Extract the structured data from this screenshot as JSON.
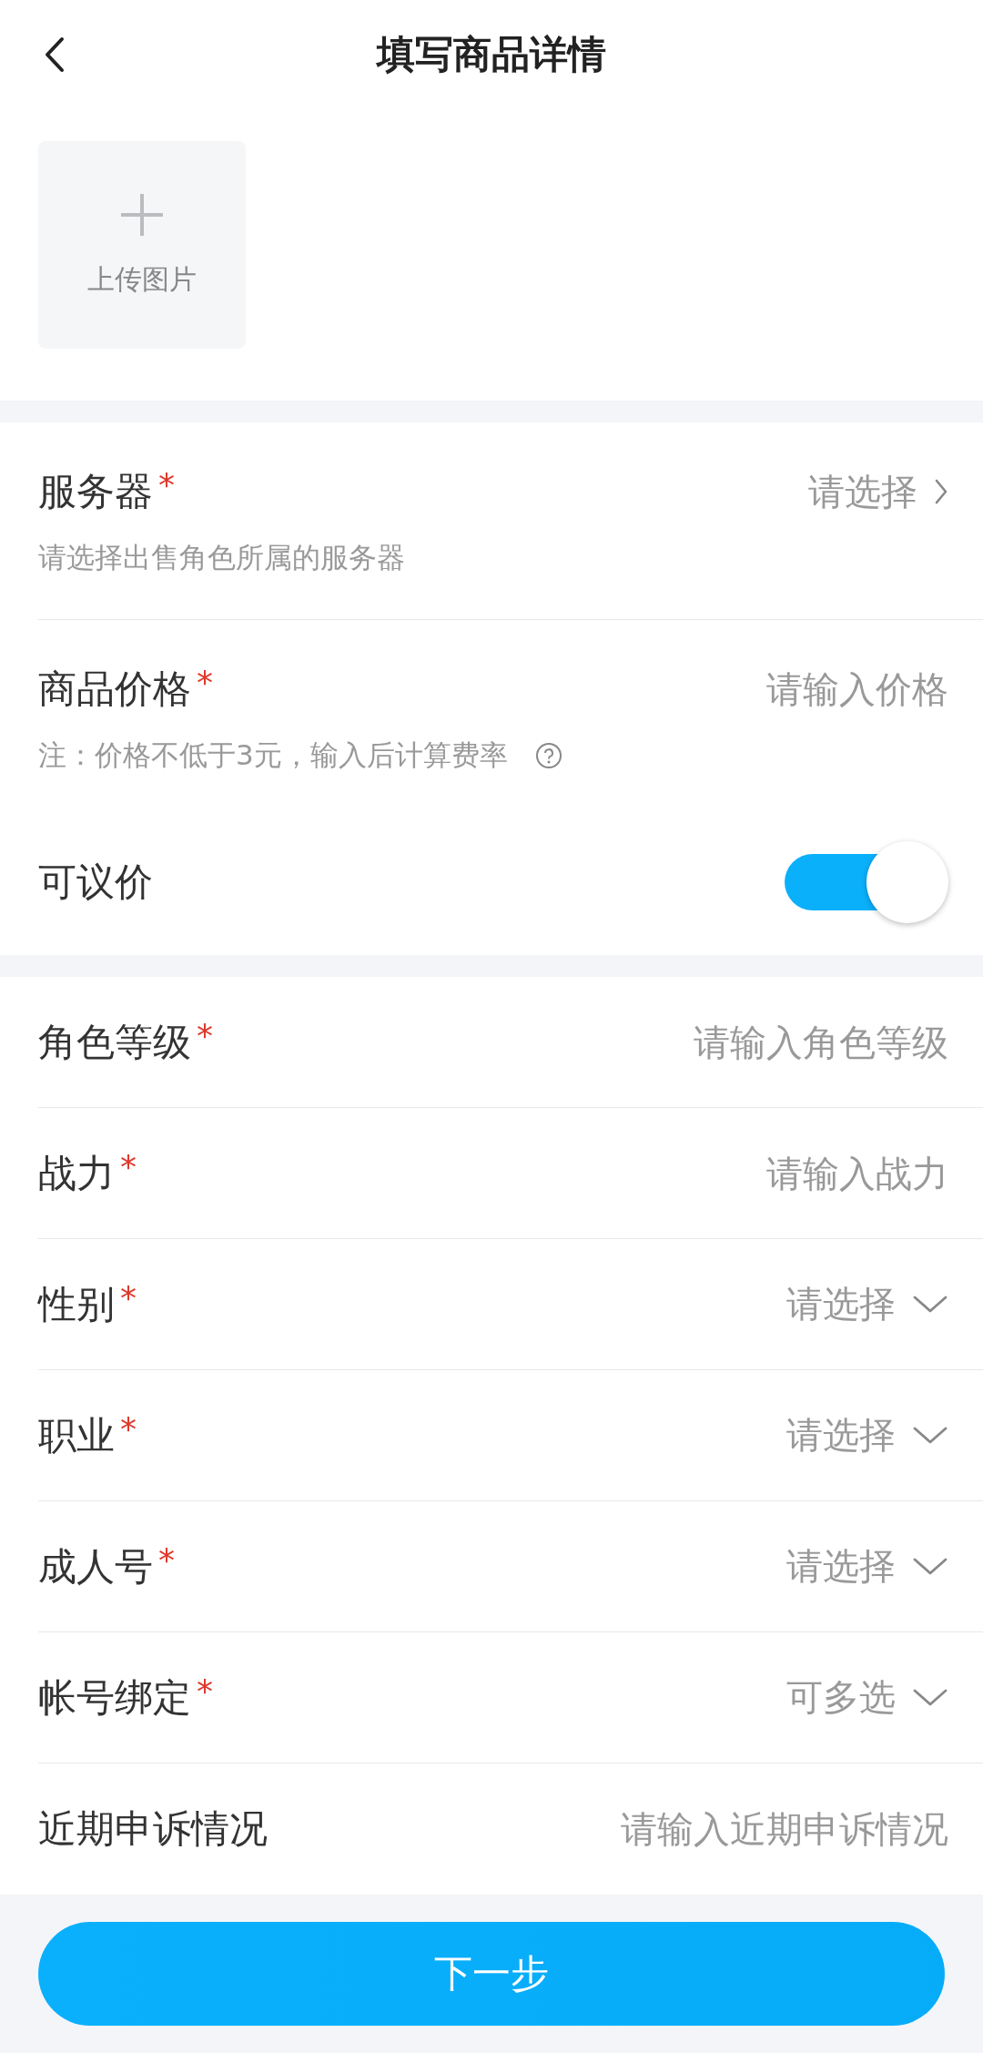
{
  "header": {
    "title": "填写商品详情"
  },
  "upload": {
    "label": "上传图片"
  },
  "required_mark": "*",
  "sections": [
    {
      "rows": [
        {
          "kind": "select",
          "label": "服务器",
          "required": true,
          "value": "请选择",
          "hint": "请选择出售角色所属的服务器"
        },
        {
          "kind": "input",
          "label": "商品价格",
          "required": true,
          "placeholder": "请输入价格",
          "hint": "注：价格不低于3元，输入后计算费率",
          "help": true
        },
        {
          "kind": "toggle",
          "label": "可议价",
          "required": false,
          "on": true
        }
      ]
    },
    {
      "rows": [
        {
          "kind": "input",
          "label": "角色等级",
          "required": true,
          "placeholder": "请输入角色等级"
        },
        {
          "kind": "input",
          "label": "战力",
          "required": true,
          "placeholder": "请输入战力"
        },
        {
          "kind": "dropdown",
          "label": "性别",
          "required": true,
          "value": "请选择"
        },
        {
          "kind": "dropdown",
          "label": "职业",
          "required": true,
          "value": "请选择"
        },
        {
          "kind": "dropdown",
          "label": "成人号",
          "required": true,
          "value": "请选择"
        },
        {
          "kind": "dropdown",
          "label": "帐号绑定",
          "required": true,
          "value": "可多选"
        },
        {
          "kind": "input",
          "label": "近期申诉情况",
          "required": false,
          "placeholder": "请输入近期申诉情况"
        }
      ]
    }
  ],
  "next_button": "下一步"
}
